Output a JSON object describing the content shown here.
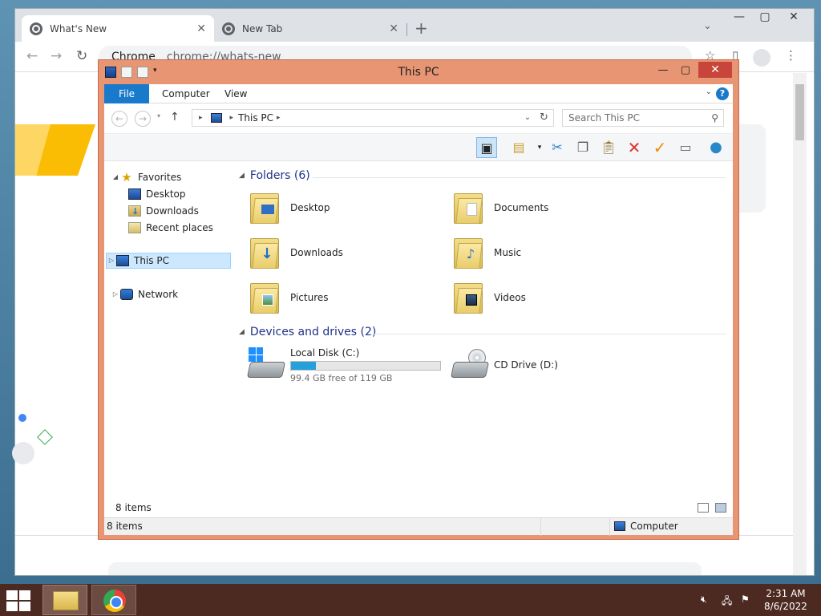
{
  "browser": {
    "tabs": [
      {
        "label": "What's New"
      },
      {
        "label": "New Tab"
      }
    ],
    "address": {
      "host": "Chrome",
      "path": "chrome://whats-new"
    }
  },
  "explorer": {
    "title": "This PC",
    "ribbon_tabs": [
      "File",
      "Computer",
      "View"
    ],
    "breadcrumb": "This PC",
    "search_placeholder": "Search This PC",
    "nav": {
      "favorites": "Favorites",
      "desktop": "Desktop",
      "downloads": "Downloads",
      "recent": "Recent places",
      "this_pc": "This PC",
      "network": "Network"
    },
    "folders_header": "Folders (6)",
    "folders": [
      {
        "name": "Desktop",
        "icon": "desktop-folder-icon"
      },
      {
        "name": "Documents",
        "icon": "documents-folder-icon"
      },
      {
        "name": "Downloads",
        "icon": "downloads-folder-icon"
      },
      {
        "name": "Music",
        "icon": "music-folder-icon"
      },
      {
        "name": "Pictures",
        "icon": "pictures-folder-icon"
      },
      {
        "name": "Videos",
        "icon": "videos-folder-icon"
      }
    ],
    "devices_header": "Devices and drives (2)",
    "drives": [
      {
        "name": "Local Disk (C:)",
        "free_text": "99.4 GB free of 119 GB",
        "used_fraction": 0.165
      },
      {
        "name": "CD Drive (D:)"
      }
    ],
    "status_items": "8 items",
    "status_items_bottom": "8 items",
    "status_computer": "Computer"
  },
  "taskbar": {
    "time": "2:31 AM",
    "date": "8/6/2022"
  }
}
